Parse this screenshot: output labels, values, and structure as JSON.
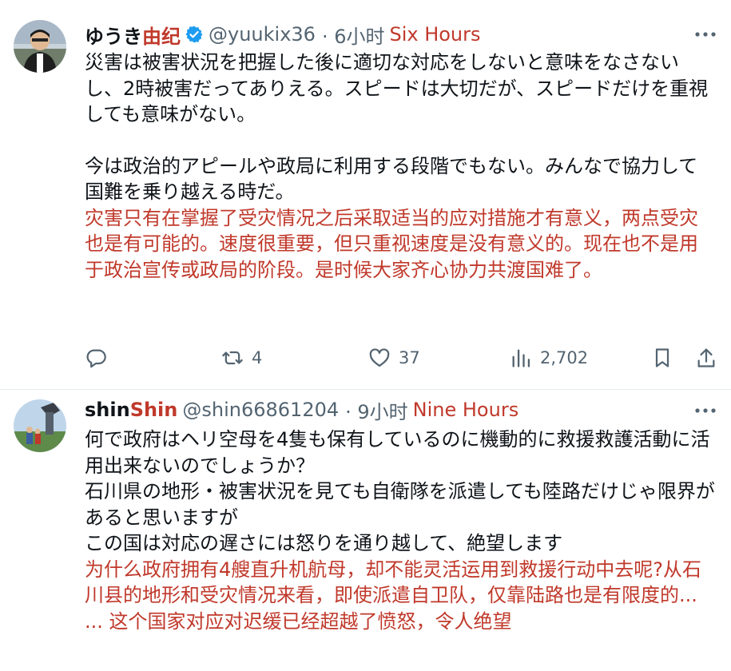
{
  "tweets": [
    {
      "name_a": "ゆうき",
      "name_b": "由纪",
      "handle": "@yuukix36",
      "time": "· 6小时",
      "time_en": "Six Hours",
      "text_jp": "災害は被害状況を把握した後に適切な対応をしないと意味をなさないし、2時被害だってありえる。スピードは大切だが、スピードだけを重視しても意味がない。",
      "text_jp2": "今は政治的アピールや政局に利用する段階でもない。みんなで協力して国難を乗り越える時だ。",
      "text_cn": "灾害只有在掌握了受灾情况之后采取适当的应对措施才有意义，两点受灾也是有可能的。速度很重要，但只重视速度是没有意义的。现在也不是用于政治宣传或政局的阶段。是时候大家齐心协力共渡国难了。",
      "reposts": "4",
      "likes": "37",
      "views": "2,702",
      "icons": [
        "reply-icon",
        "repost-icon",
        "like-icon",
        "views-icon",
        "bookmark-icon",
        "share-icon",
        "verified-badge-icon",
        "more-icon"
      ]
    },
    {
      "name_a": "shin",
      "name_b": "Shin",
      "handle": "@shin66861204",
      "time": "· 9小时",
      "time_en": "Nine Hours",
      "text_jp_lines": [
        "何で政府はヘリ空母を4隻も保有しているのに機動的に救援救護活動に活用出来ないのでしょうか？",
        "石川県の地形・被害状況を見ても自衛隊を派遣しても陸路だけじゃ限界があると思いますが",
        "この国は対応の遅さには怒りを通り越して、絶望します"
      ],
      "text_cn": "为什么政府拥有4艘直升机航母，却不能灵活运用到救援行动中去呢?从石川县的地形和受灾情况来看，即使派遣自卫队，仅靠陆路也是有限度的... ... 这个国家对应对迟缓已经超越了愤怒，令人绝望"
    }
  ],
  "colors": {
    "text": "#0f1419",
    "muted": "#536471",
    "translation": "#c0392b",
    "verified": "#1d9bf0",
    "divider": "#e6ecf0"
  }
}
